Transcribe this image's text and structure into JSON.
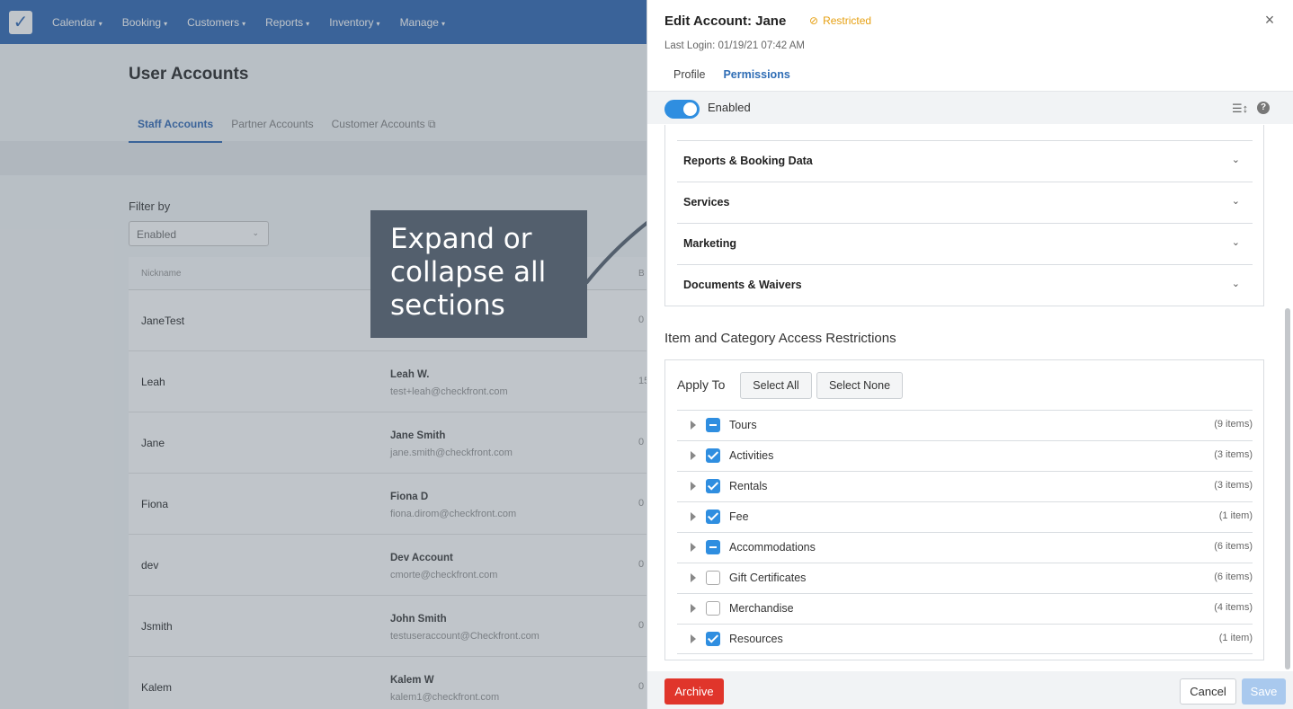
{
  "background": {
    "nav": [
      {
        "label": "Calendar"
      },
      {
        "label": "Booking"
      },
      {
        "label": "Customers"
      },
      {
        "label": "Reports"
      },
      {
        "label": "Inventory"
      },
      {
        "label": "Manage"
      }
    ],
    "page_title": "User Accounts",
    "tabs": [
      {
        "label": "Staff Accounts"
      },
      {
        "label": "Partner Accounts"
      },
      {
        "label": "Customer Accounts"
      }
    ],
    "filter_label": "Filter by",
    "filter_value": "Enabled",
    "table_header": {
      "nickname": "Nickname",
      "col3": "B"
    },
    "rows": [
      {
        "nickname": "JaneTest",
        "name": "",
        "email": "",
        "num": "0"
      },
      {
        "nickname": "Leah",
        "name": "Leah W.",
        "email": "test+leah@checkfront.com",
        "num": "15"
      },
      {
        "nickname": "Jane",
        "name": "Jane Smith",
        "email": "jane.smith@checkfront.com",
        "num": "0"
      },
      {
        "nickname": "Fiona",
        "name": "Fiona D",
        "email": "fiona.dirom@checkfront.com",
        "num": "0"
      },
      {
        "nickname": "dev",
        "name": "Dev Account",
        "email": "cmorte@checkfront.com",
        "num": "0"
      },
      {
        "nickname": "Jsmith",
        "name": "John Smith",
        "email": "testuseraccount@Checkfront.com",
        "num": "0"
      },
      {
        "nickname": "Kalem",
        "name": "Kalem W",
        "email": "kalem1@checkfront.com",
        "num": "0"
      }
    ]
  },
  "callout": {
    "text": "Expand or collapse all sections"
  },
  "panel": {
    "title": "Edit Account: Jane",
    "status": "Restricted",
    "last_login": "Last Login: 01/19/21 07:42 AM",
    "tabs": [
      {
        "label": "Profile"
      },
      {
        "label": "Permissions"
      }
    ],
    "toggle_label": "Enabled",
    "sections": [
      {
        "label": "Reports & Booking Data"
      },
      {
        "label": "Services"
      },
      {
        "label": "Marketing"
      },
      {
        "label": "Documents & Waivers"
      }
    ],
    "iac_title": "Item and Category Access Restrictions",
    "apply_to": "Apply To",
    "select_all": "Select All",
    "select_none": "Select None",
    "items": [
      {
        "name": "Tours",
        "count": "(9 items)",
        "state": "partial"
      },
      {
        "name": "Activities",
        "count": "(3 items)",
        "state": "checked"
      },
      {
        "name": "Rentals",
        "count": "(3 items)",
        "state": "checked"
      },
      {
        "name": "Fee",
        "count": "(1 item)",
        "state": "checked"
      },
      {
        "name": "Accommodations",
        "count": "(6 items)",
        "state": "partial"
      },
      {
        "name": "Gift Certificates",
        "count": "(6 items)",
        "state": "unchecked"
      },
      {
        "name": "Merchandise",
        "count": "(4 items)",
        "state": "unchecked"
      },
      {
        "name": "Resources",
        "count": "(1 item)",
        "state": "checked"
      }
    ],
    "archive": "Archive",
    "cancel": "Cancel",
    "save": "Save"
  },
  "colors": {
    "accent": "#2f8ee0",
    "nav": "#3a6fb7",
    "warning": "#e6a012",
    "danger": "#e0352b"
  }
}
